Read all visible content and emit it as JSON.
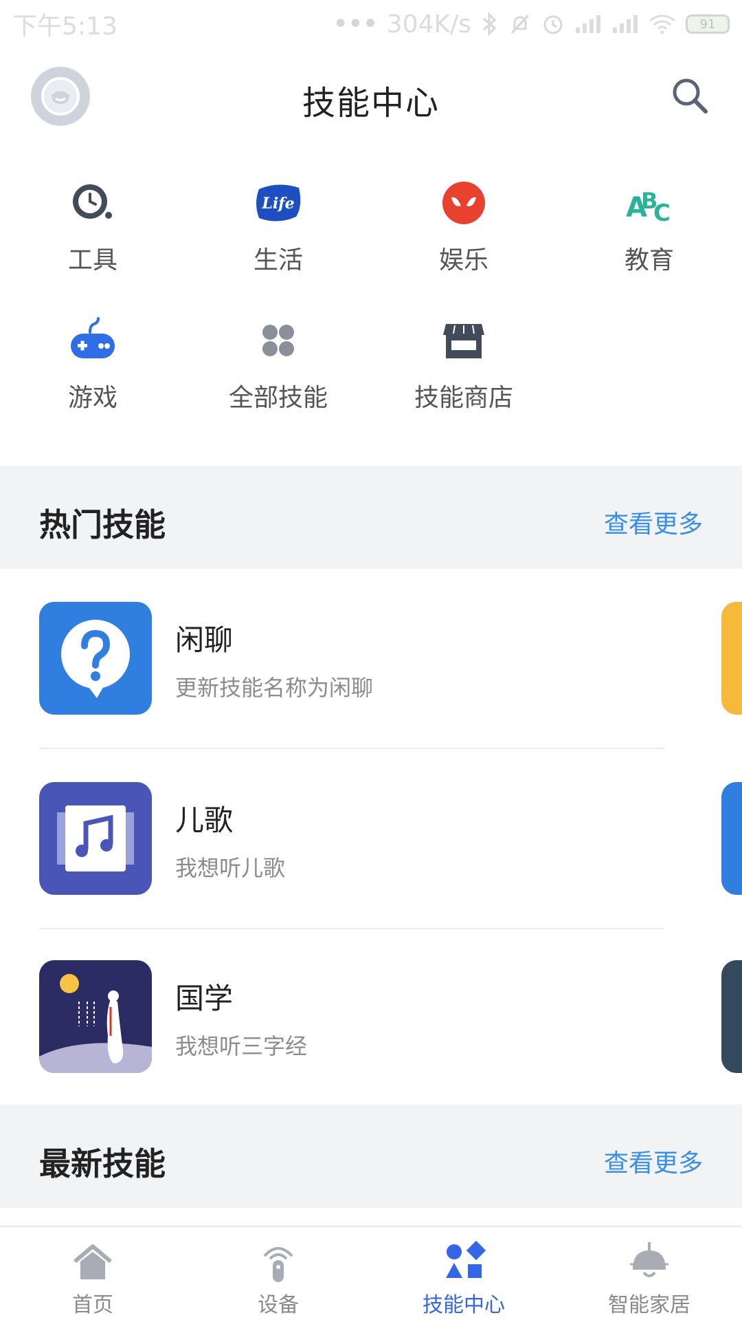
{
  "status_bar": {
    "time": "下午5:13",
    "dots": "•••",
    "speed": "304K/s",
    "battery": "91"
  },
  "header": {
    "title": "技能中心"
  },
  "categories": [
    {
      "label": "工具",
      "icon": "clock-icon"
    },
    {
      "label": "生活",
      "icon": "life-icon"
    },
    {
      "label": "娱乐",
      "icon": "mask-icon"
    },
    {
      "label": "教育",
      "icon": "abc-icon"
    },
    {
      "label": "游戏",
      "icon": "gamepad-icon"
    },
    {
      "label": "全部技能",
      "icon": "grid-dots-icon"
    },
    {
      "label": "技能商店",
      "icon": "store-icon"
    }
  ],
  "hot_skills": {
    "title": "热门技能",
    "more": "查看更多",
    "items": [
      {
        "name": "闲聊",
        "desc": "更新技能名称为闲聊",
        "icon": "question-bubble-icon"
      },
      {
        "name": "儿歌",
        "desc": "我想听儿歌",
        "icon": "music-note-icon"
      },
      {
        "name": "国学",
        "desc": "我想听三字经",
        "icon": "poet-moon-icon"
      }
    ]
  },
  "new_skills": {
    "title": "最新技能",
    "more": "查看更多"
  },
  "tabbar": {
    "items": [
      {
        "label": "首页",
        "icon": "home-icon"
      },
      {
        "label": "设备",
        "icon": "device-icon"
      },
      {
        "label": "技能中心",
        "icon": "shapes-icon",
        "active": true
      },
      {
        "label": "智能家居",
        "icon": "lamp-icon"
      }
    ]
  },
  "colors": {
    "accent": "#3566e8",
    "link": "#3a8ee6",
    "section_bg": "#f2f3f5"
  }
}
